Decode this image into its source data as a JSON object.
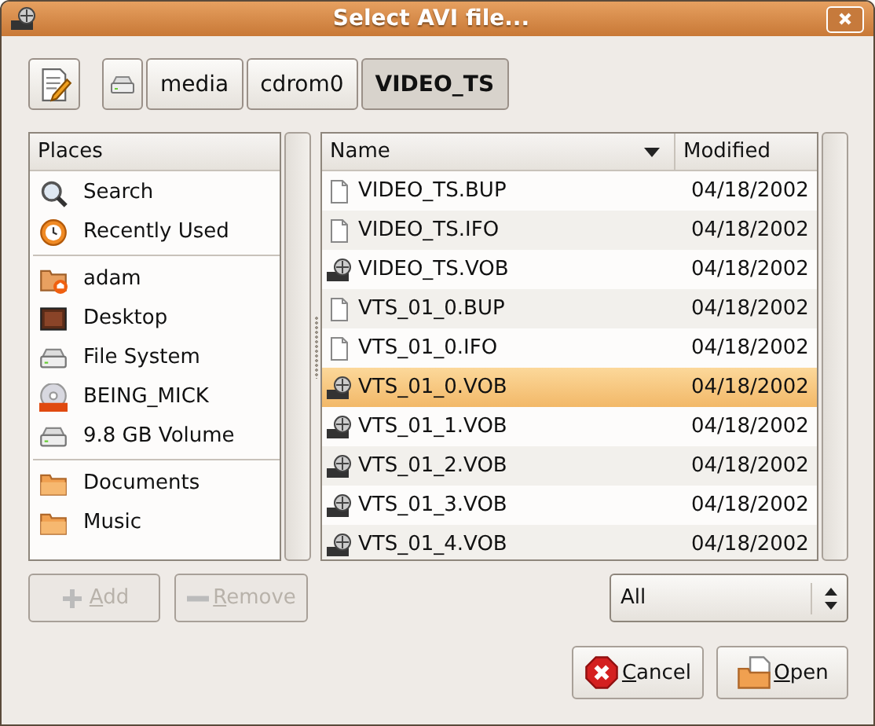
{
  "window": {
    "title": "Select AVI file..."
  },
  "path_bar": {
    "segments": [
      {
        "label": "media",
        "selected": false
      },
      {
        "label": "cdrom0",
        "selected": false
      },
      {
        "label": "VIDEO_TS",
        "selected": true
      }
    ]
  },
  "places": {
    "header": "Places",
    "groups": [
      {
        "items": [
          {
            "label": "Search",
            "kind": "search"
          },
          {
            "label": "Recently Used",
            "kind": "recent"
          }
        ]
      },
      {
        "items": [
          {
            "label": "adam",
            "kind": "home"
          },
          {
            "label": "Desktop",
            "kind": "desktop"
          },
          {
            "label": "File System",
            "kind": "drive"
          },
          {
            "label": "BEING_MICK",
            "kind": "dvd"
          },
          {
            "label": "9.8 GB Volume",
            "kind": "drive"
          }
        ]
      },
      {
        "items": [
          {
            "label": "Documents",
            "kind": "folder"
          },
          {
            "label": "Music",
            "kind": "folder"
          }
        ]
      }
    ]
  },
  "files": {
    "columns": [
      "Name",
      "Modified"
    ],
    "rows": [
      {
        "name": "VIDEO_TS.BUP",
        "modified": "04/18/2002",
        "kind": "document",
        "selected": false
      },
      {
        "name": "VIDEO_TS.IFO",
        "modified": "04/18/2002",
        "kind": "document",
        "selected": false
      },
      {
        "name": "VIDEO_TS.VOB",
        "modified": "04/18/2002",
        "kind": "video",
        "selected": false
      },
      {
        "name": "VTS_01_0.BUP",
        "modified": "04/18/2002",
        "kind": "document",
        "selected": false
      },
      {
        "name": "VTS_01_0.IFO",
        "modified": "04/18/2002",
        "kind": "document",
        "selected": false
      },
      {
        "name": "VTS_01_0.VOB",
        "modified": "04/18/2002",
        "kind": "video",
        "selected": true
      },
      {
        "name": "VTS_01_1.VOB",
        "modified": "04/18/2002",
        "kind": "video",
        "selected": false
      },
      {
        "name": "VTS_01_2.VOB",
        "modified": "04/18/2002",
        "kind": "video",
        "selected": false
      },
      {
        "name": "VTS_01_3.VOB",
        "modified": "04/18/2002",
        "kind": "video",
        "selected": false
      },
      {
        "name": "VTS_01_4.VOB",
        "modified": "04/18/2002",
        "kind": "video",
        "selected": false
      }
    ]
  },
  "place_buttons": [
    {
      "label": "Add",
      "kind": "add",
      "disabled": true
    },
    {
      "label": "Remove",
      "kind": "remove",
      "disabled": true
    }
  ],
  "filter": {
    "value": "All"
  },
  "buttons": [
    {
      "label": "Cancel",
      "kind": "cancel"
    },
    {
      "label": "Open",
      "kind": "open"
    }
  ]
}
